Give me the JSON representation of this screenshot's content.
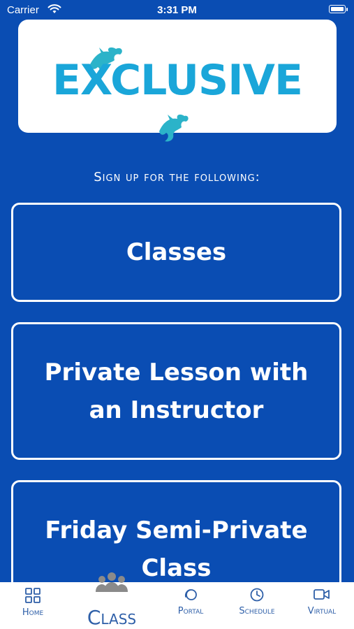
{
  "status_bar": {
    "carrier": "Carrier",
    "time": "3:31 PM"
  },
  "logo": {
    "text": "EXCLUSIVE",
    "colors": {
      "primary": "#1aa6d9",
      "dragon": "#2bb3c9"
    }
  },
  "signup": {
    "heading": "Sign up for the following:"
  },
  "options": [
    {
      "label": "Classes"
    },
    {
      "label": "Private Lesson with an Instructor"
    },
    {
      "label": "Friday Semi-Private Class"
    }
  ],
  "tab_bar": {
    "tabs": [
      {
        "label": "Home",
        "icon": "grid-icon"
      },
      {
        "label": "Class",
        "icon": "group-icon",
        "selected": true
      },
      {
        "label": "Portal",
        "icon": "portal-icon"
      },
      {
        "label": "Schedule",
        "icon": "clock-icon"
      },
      {
        "label": "Virtual",
        "icon": "video-icon"
      }
    ]
  },
  "colors": {
    "background": "#0a4db3",
    "card_border": "#ffffff",
    "tab_tint": "#2e5fa8"
  }
}
